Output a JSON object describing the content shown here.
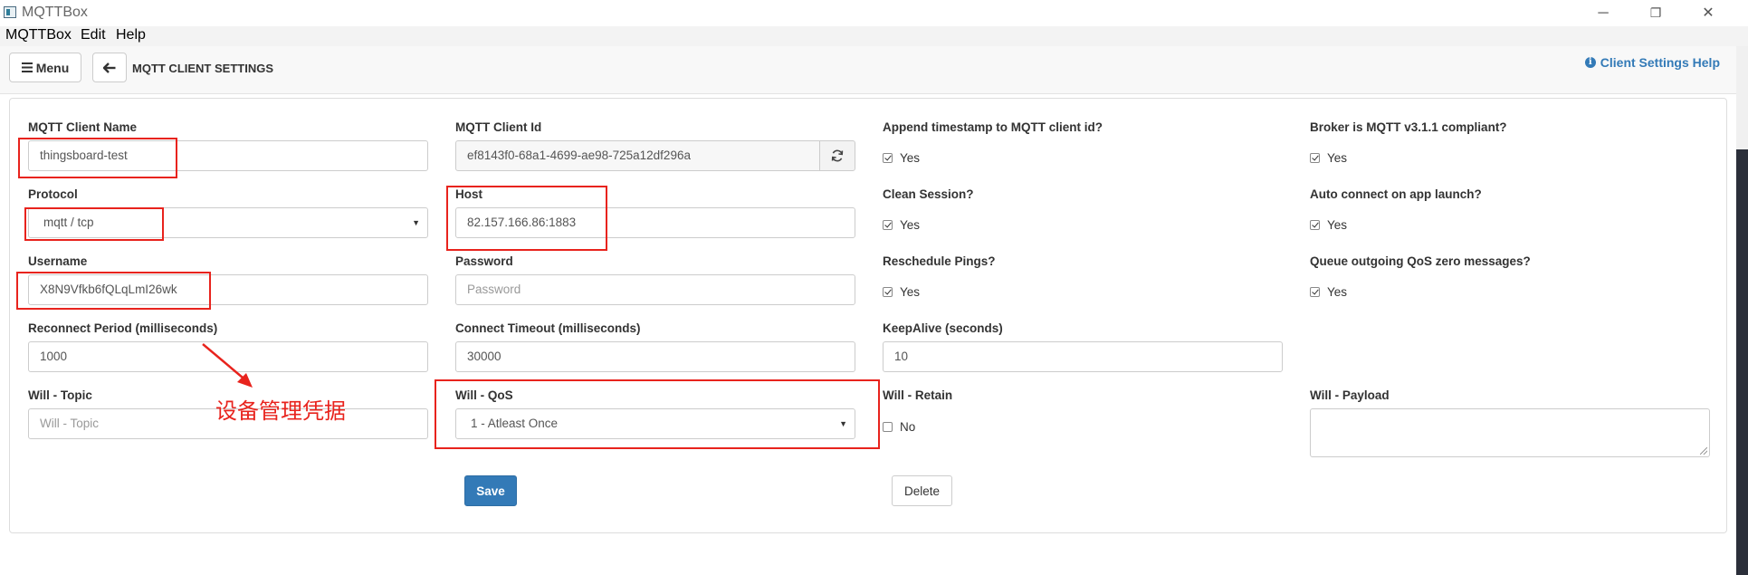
{
  "window": {
    "title": "MQTTBox",
    "controls": {
      "minimize": "─",
      "maximize": "❐",
      "close": "✕"
    }
  },
  "menubar": {
    "items": [
      "MQTTBox",
      "Edit",
      "Help"
    ]
  },
  "toolbar": {
    "menu_label": "Menu",
    "page_title": "MQTT CLIENT SETTINGS",
    "help_label": "Client Settings Help"
  },
  "form": {
    "client_name": {
      "label": "MQTT Client Name",
      "value": "thingsboard-test"
    },
    "client_id": {
      "label": "MQTT Client Id",
      "value": "ef8143f0-68a1-4699-ae98-725a12df296a"
    },
    "append_timestamp": {
      "label": "Append timestamp to MQTT client id?",
      "option": "Yes",
      "checked": true
    },
    "broker_compliant": {
      "label": "Broker is MQTT v3.1.1 compliant?",
      "option": "Yes",
      "checked": true
    },
    "protocol": {
      "label": "Protocol",
      "value": "mqtt / tcp"
    },
    "host": {
      "label": "Host",
      "value": "82.157.166.86:1883"
    },
    "clean_session": {
      "label": "Clean Session?",
      "option": "Yes",
      "checked": true
    },
    "auto_connect": {
      "label": "Auto connect on app launch?",
      "option": "Yes",
      "checked": true
    },
    "username": {
      "label": "Username",
      "value": "X8N9Vfkb6fQLqLmI26wk"
    },
    "password": {
      "label": "Password",
      "placeholder": "Password"
    },
    "reschedule_pings": {
      "label": "Reschedule Pings?",
      "option": "Yes",
      "checked": true
    },
    "queue_qos_zero": {
      "label": "Queue outgoing QoS zero messages?",
      "option": "Yes",
      "checked": true
    },
    "reconnect_period": {
      "label": "Reconnect Period (milliseconds)",
      "value": "1000"
    },
    "connect_timeout": {
      "label": "Connect Timeout (milliseconds)",
      "value": "30000"
    },
    "keepalive": {
      "label": "KeepAlive (seconds)",
      "value": "10"
    },
    "will_topic": {
      "label": "Will - Topic",
      "placeholder": "Will - Topic"
    },
    "will_qos": {
      "label": "Will - QoS",
      "value": "1 - Atleast Once"
    },
    "will_retain": {
      "label": "Will - Retain",
      "option": "No",
      "checked": false
    },
    "will_payload": {
      "label": "Will - Payload",
      "value": ""
    },
    "save_label": "Save",
    "delete_label": "Delete"
  },
  "annotation": {
    "text": "设备管理凭据",
    "color": "#e8231d"
  },
  "colors": {
    "primary": "#337ab7",
    "annotation": "#e8231d"
  }
}
